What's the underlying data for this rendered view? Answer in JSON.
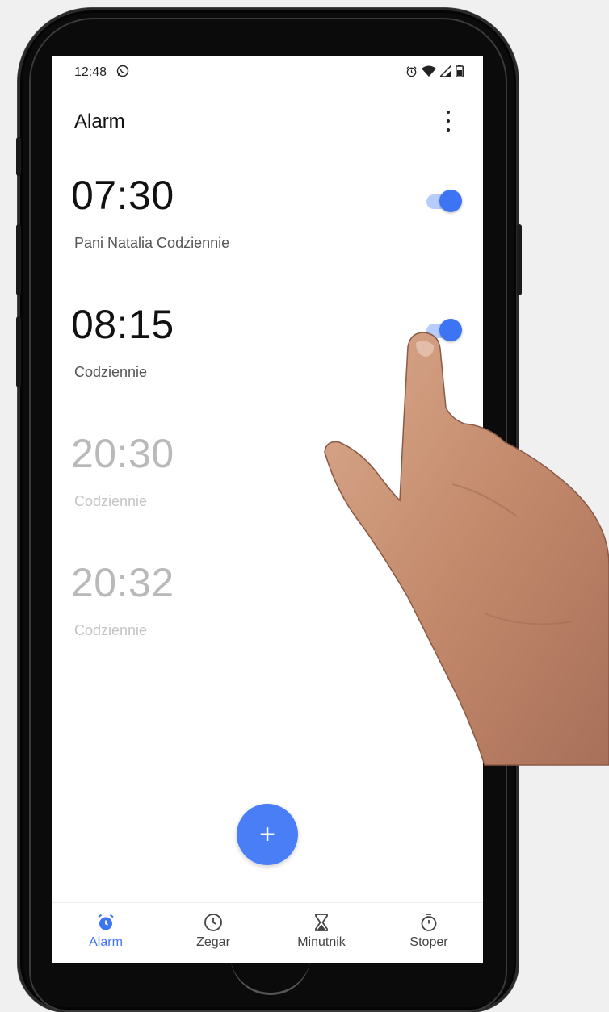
{
  "status_bar": {
    "time": "12:48",
    "icons": [
      "whatsapp-icon",
      "alarm-icon",
      "wifi-icon",
      "signal-icon",
      "battery-icon"
    ]
  },
  "app_bar": {
    "title": "Alarm",
    "menu_icon": "more-vert-icon"
  },
  "alarms": [
    {
      "time": "07:30",
      "label": "Pani Natalia  Codziennie",
      "enabled": true
    },
    {
      "time": "08:15",
      "label": "Codziennie",
      "enabled": true
    },
    {
      "time": "20:30",
      "label": "Codziennie",
      "enabled": false
    },
    {
      "time": "20:32",
      "label": "Codziennie",
      "enabled": false
    }
  ],
  "fab": {
    "label": "+"
  },
  "bottom_nav": [
    {
      "label": "Alarm",
      "icon": "alarm-clock-icon",
      "active": true
    },
    {
      "label": "Zegar",
      "icon": "clock-icon",
      "active": false
    },
    {
      "label": "Minutnik",
      "icon": "hourglass-icon",
      "active": false
    },
    {
      "label": "Stoper",
      "icon": "stopwatch-icon",
      "active": false
    }
  ],
  "colors": {
    "accent": "#3d74f4",
    "toggle_track": "#b8cdfb",
    "fab": "#4a7ef6",
    "inactive_time": "#b9b9b9"
  }
}
